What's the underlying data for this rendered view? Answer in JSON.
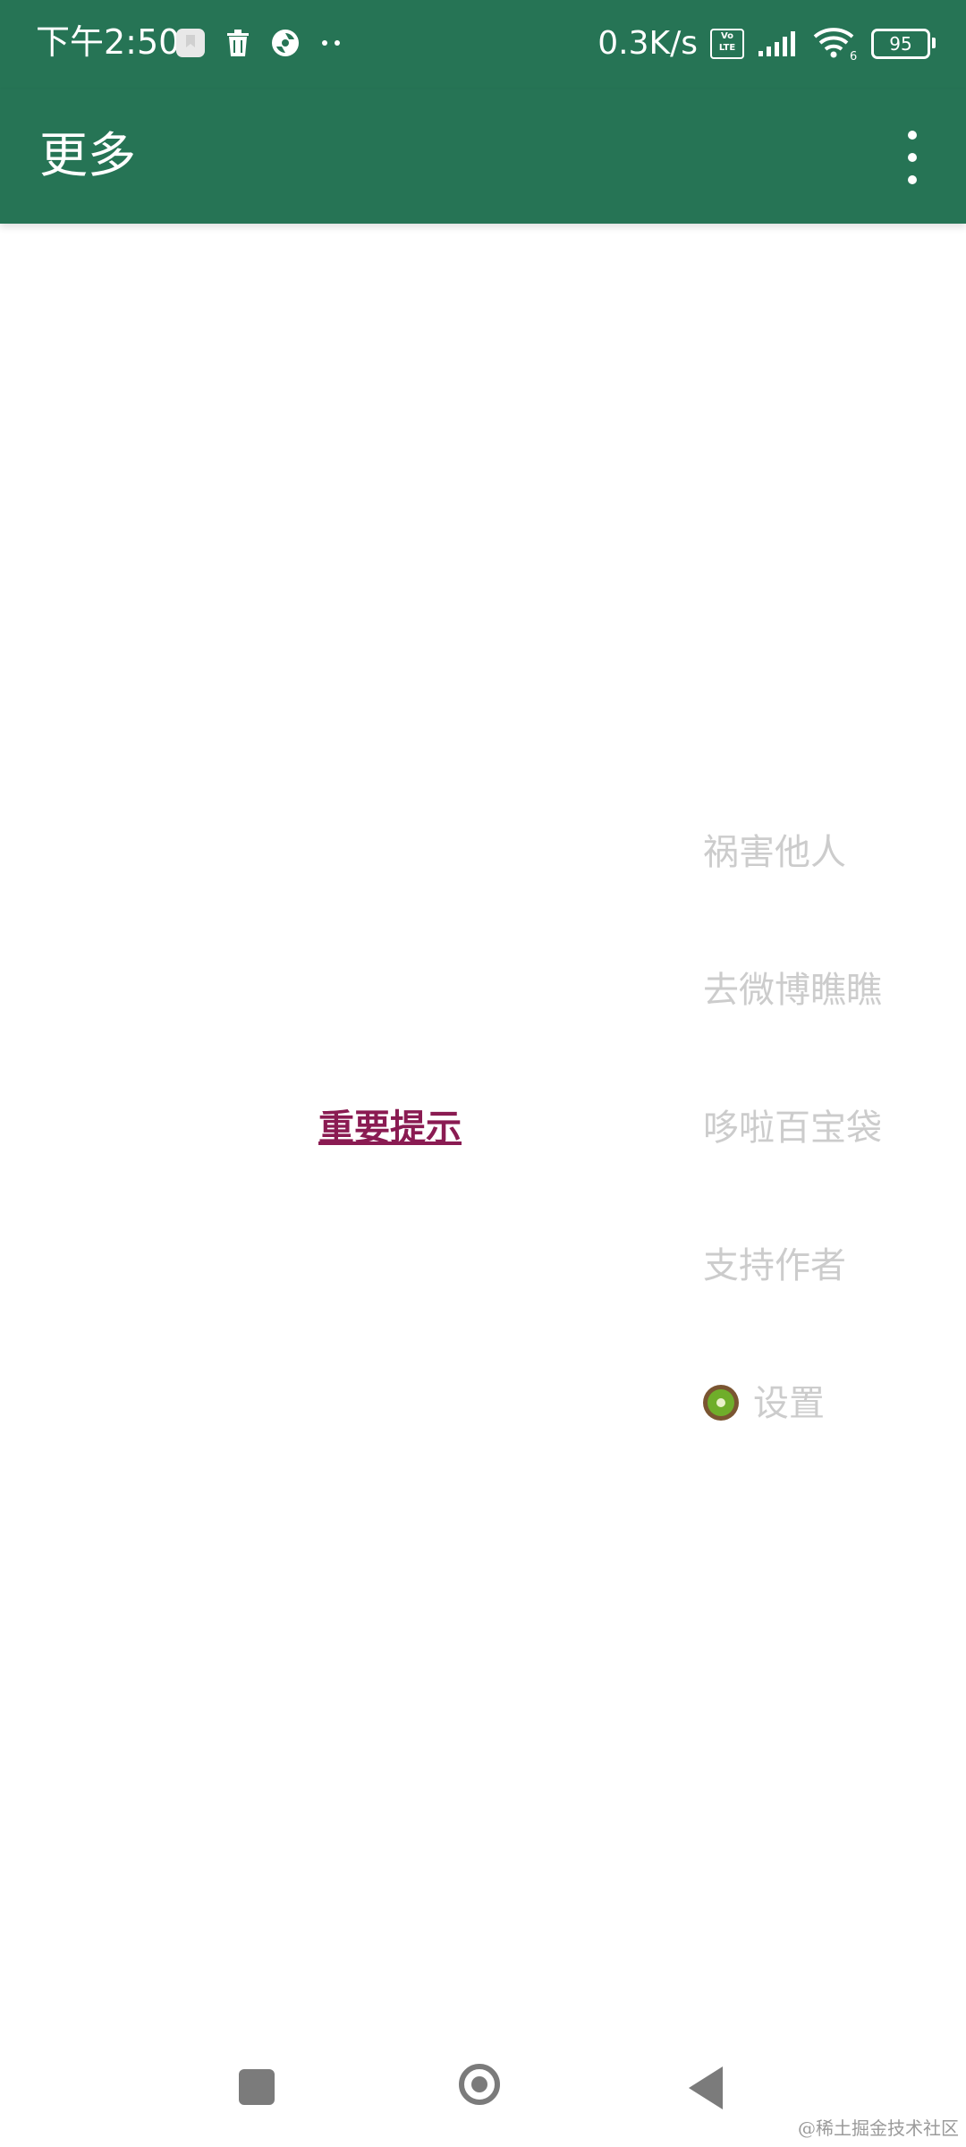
{
  "status_bar": {
    "time": "下午2:50",
    "net_speed": "0.3K/s",
    "volte_top": "Vo",
    "volte_bottom": "LTE",
    "wifi_badge": "6",
    "battery": "95",
    "icons": [
      "notification-icon",
      "trash-icon",
      "sync-icon",
      "more-dots-icon",
      "volte-icon",
      "signal-icon",
      "wifi-icon",
      "battery-icon"
    ]
  },
  "toolbar": {
    "title": "更多",
    "overflow_icon": "more-vert-icon",
    "background": "#267455"
  },
  "content": {
    "notice_link": "重要提示",
    "notice_color": "#8a1b52"
  },
  "menu": {
    "items": [
      {
        "label": "祸害他人"
      },
      {
        "label": "去微博瞧瞧"
      },
      {
        "label": "哆啦百宝袋"
      },
      {
        "label": "支持作者"
      },
      {
        "label": "设置",
        "icon": "kiwi-icon"
      }
    ],
    "text_color": "#cccccc"
  },
  "navigation_bar": {
    "icons": [
      "recent-apps-icon",
      "home-icon",
      "back-icon"
    ]
  },
  "watermark": "@稀土掘金技术社区"
}
